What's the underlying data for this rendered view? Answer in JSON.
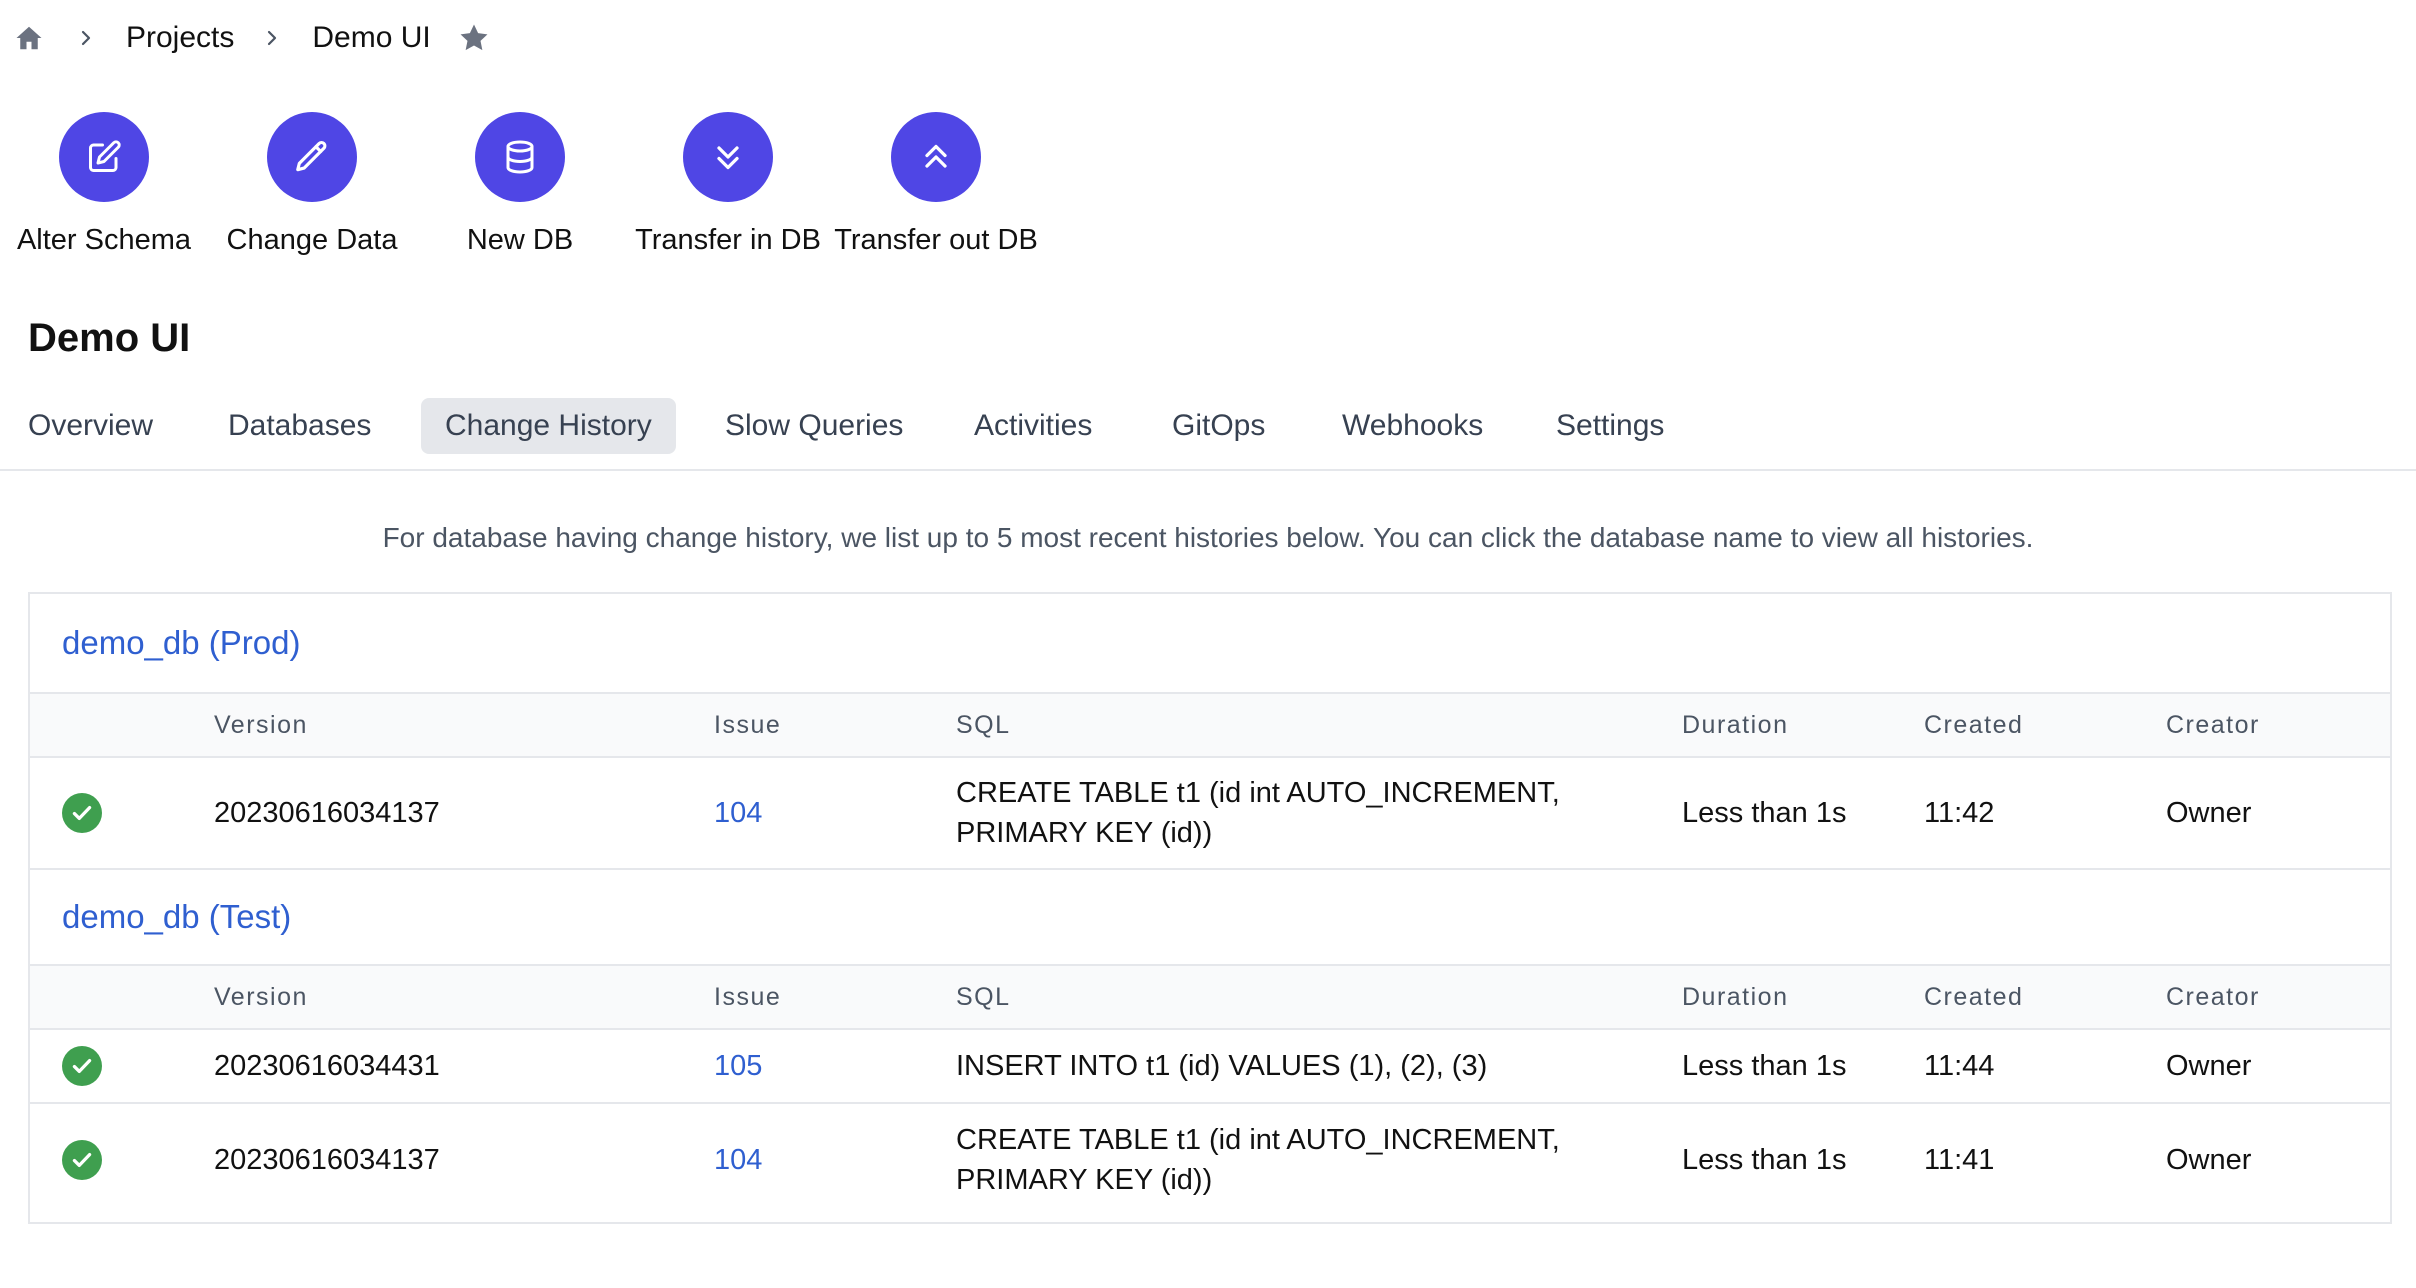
{
  "breadcrumb": {
    "items": [
      "Projects",
      "Demo UI"
    ]
  },
  "actions": [
    {
      "label": "Alter Schema",
      "icon": "edit-square-icon"
    },
    {
      "label": "Change Data",
      "icon": "pencil-icon"
    },
    {
      "label": "New DB",
      "icon": "database-icon"
    },
    {
      "label": "Transfer in DB",
      "icon": "chevrons-down-icon"
    },
    {
      "label": "Transfer out DB",
      "icon": "chevrons-up-icon"
    }
  ],
  "project": {
    "title": "Demo UI"
  },
  "tabs": [
    "Overview",
    "Databases",
    "Change History",
    "Slow Queries",
    "Activities",
    "GitOps",
    "Webhooks",
    "Settings"
  ],
  "active_tab": "Change History",
  "info_text": "For database having change history, we list up to 5 most recent histories below. You can click the database name to view all histories.",
  "columns": {
    "version": "Version",
    "issue": "Issue",
    "sql": "SQL",
    "duration": "Duration",
    "created": "Created",
    "creator": "Creator"
  },
  "groups": [
    {
      "title": "demo_db (Prod)",
      "rows": [
        {
          "status": "done",
          "version": "20230616034137",
          "issue": "104",
          "sql": "CREATE TABLE t1 (id int AUTO_INCREMENT, PRIMARY KEY (id))",
          "duration": "Less than 1s",
          "created": "11:42",
          "creator": "Owner"
        }
      ]
    },
    {
      "title": "demo_db (Test)",
      "rows": [
        {
          "status": "done",
          "version": "20230616034431",
          "issue": "105",
          "sql": "INSERT INTO t1 (id) VALUES (1), (2), (3)",
          "duration": "Less than 1s",
          "created": "11:44",
          "creator": "Owner"
        },
        {
          "status": "done",
          "version": "20230616034137",
          "issue": "104",
          "sql": "CREATE TABLE t1 (id int AUTO_INCREMENT, PRIMARY KEY (id))",
          "duration": "Less than 1s",
          "created": "11:41",
          "creator": "Owner"
        }
      ]
    }
  ],
  "colors": {
    "accent": "#4f46e5",
    "link": "#2f5fd0",
    "success": "#3f9f4f"
  }
}
